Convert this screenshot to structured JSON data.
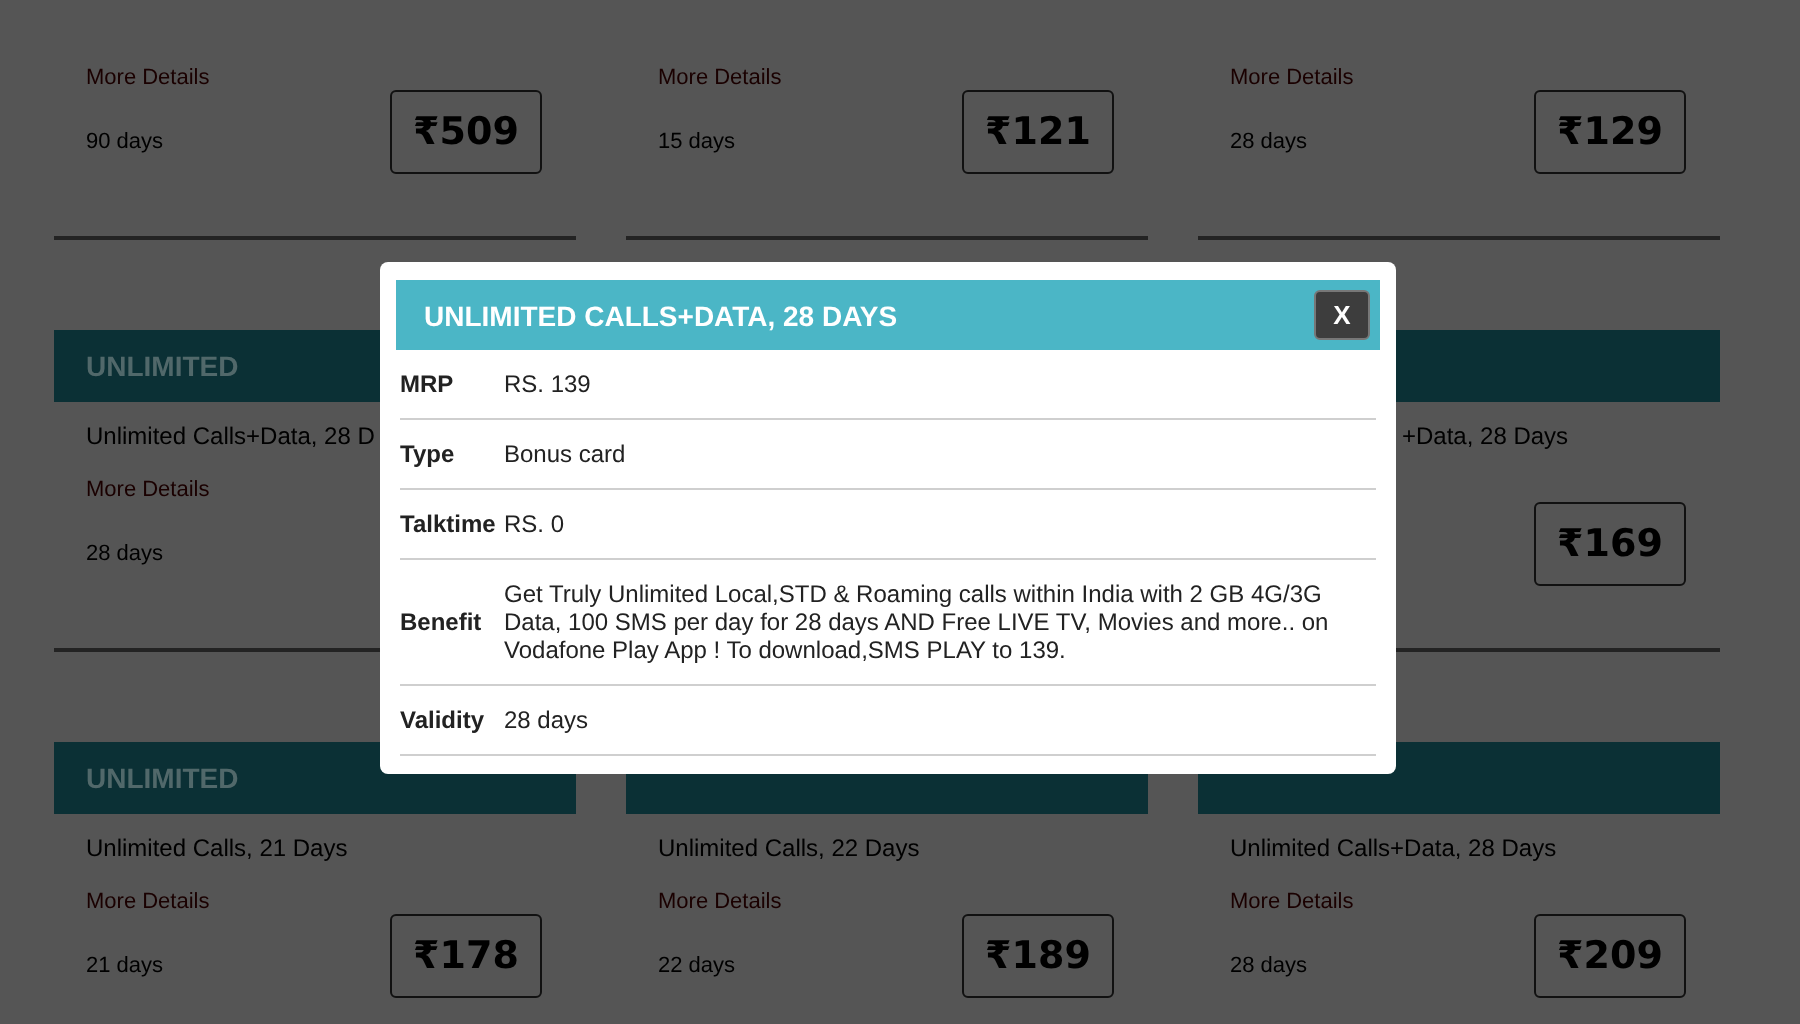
{
  "plan_rows": [
    {
      "cards": [
        {
          "kind": "cut",
          "more_details": "More Details",
          "validity": "90 days",
          "price": "₹509"
        },
        {
          "kind": "cut",
          "more_details": "More Details",
          "validity": "15 days",
          "price": "₹121"
        },
        {
          "kind": "cut",
          "more_details": "More Details",
          "validity": "28 days",
          "price": "₹129"
        }
      ]
    },
    {
      "cards": [
        {
          "kind": "headed",
          "category": "UNLIMITED",
          "description": "Unlimited Calls+Data, 28 D",
          "more_details": "More Details",
          "validity": "28 days"
        },
        {
          "kind": "hidden"
        },
        {
          "kind": "headed",
          "description": "+Data, 28 Days",
          "price": "₹169"
        }
      ]
    },
    {
      "cards": [
        {
          "kind": "headed",
          "category": "UNLIMITED",
          "description": "Unlimited Calls, 21 Days",
          "more_details": "More Details",
          "validity": "21 days",
          "price": "₹178"
        },
        {
          "kind": "headed",
          "description": "Unlimited Calls, 22 Days",
          "more_details": "More Details",
          "validity": "22 days",
          "price": "₹189"
        },
        {
          "kind": "headed",
          "description": "Unlimited Calls+Data, 28 Days",
          "more_details": "More Details",
          "validity": "28 days",
          "price": "₹209"
        }
      ]
    }
  ],
  "modal": {
    "title": "UNLIMITED CALLS+DATA, 28 DAYS",
    "close": "X",
    "rows": [
      {
        "label": "MRP",
        "value": "RS. 139"
      },
      {
        "label": "Type",
        "value": "Bonus card"
      },
      {
        "label": "Talktime",
        "value": "RS. 0"
      },
      {
        "label": "Benefit",
        "value": "Get Truly Unlimited Local,STD & Roaming calls within India with 2 GB 4G/3G Data, 100 SMS per day for 28 days AND Free LIVE TV, Movies and more.. on Vodafone Play App ! To download,SMS PLAY to 139."
      },
      {
        "label": "Validity",
        "value": "28 days"
      }
    ]
  }
}
